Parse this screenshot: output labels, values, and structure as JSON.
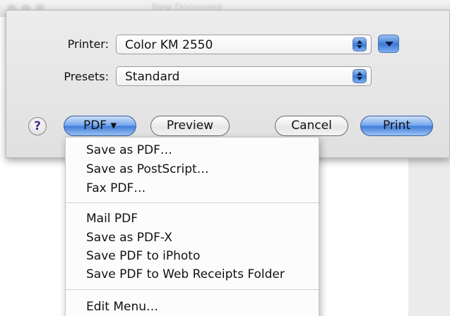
{
  "background": {
    "title": "New Document"
  },
  "print_dialog": {
    "printer": {
      "label": "Printer:",
      "value": "Color KM 2550"
    },
    "presets": {
      "label": "Presets:",
      "value": "Standard"
    },
    "buttons": {
      "help": "?",
      "pdf": "PDF ▾",
      "preview": "Preview",
      "cancel": "Cancel",
      "print": "Print"
    }
  },
  "pdf_menu": {
    "groups": [
      [
        "Save as PDF…",
        "Save as PostScript…",
        "Fax PDF…"
      ],
      [
        "Mail PDF",
        "Save as PDF-X",
        "Save PDF to iPhoto",
        "Save PDF to Web Receipts Folder"
      ],
      [
        "Edit Menu…"
      ]
    ]
  },
  "colors": {
    "aqua_blue": "#3e7ad8",
    "sheet_gray": "#e6e6e6",
    "help_purple": "#4a2a8c"
  }
}
